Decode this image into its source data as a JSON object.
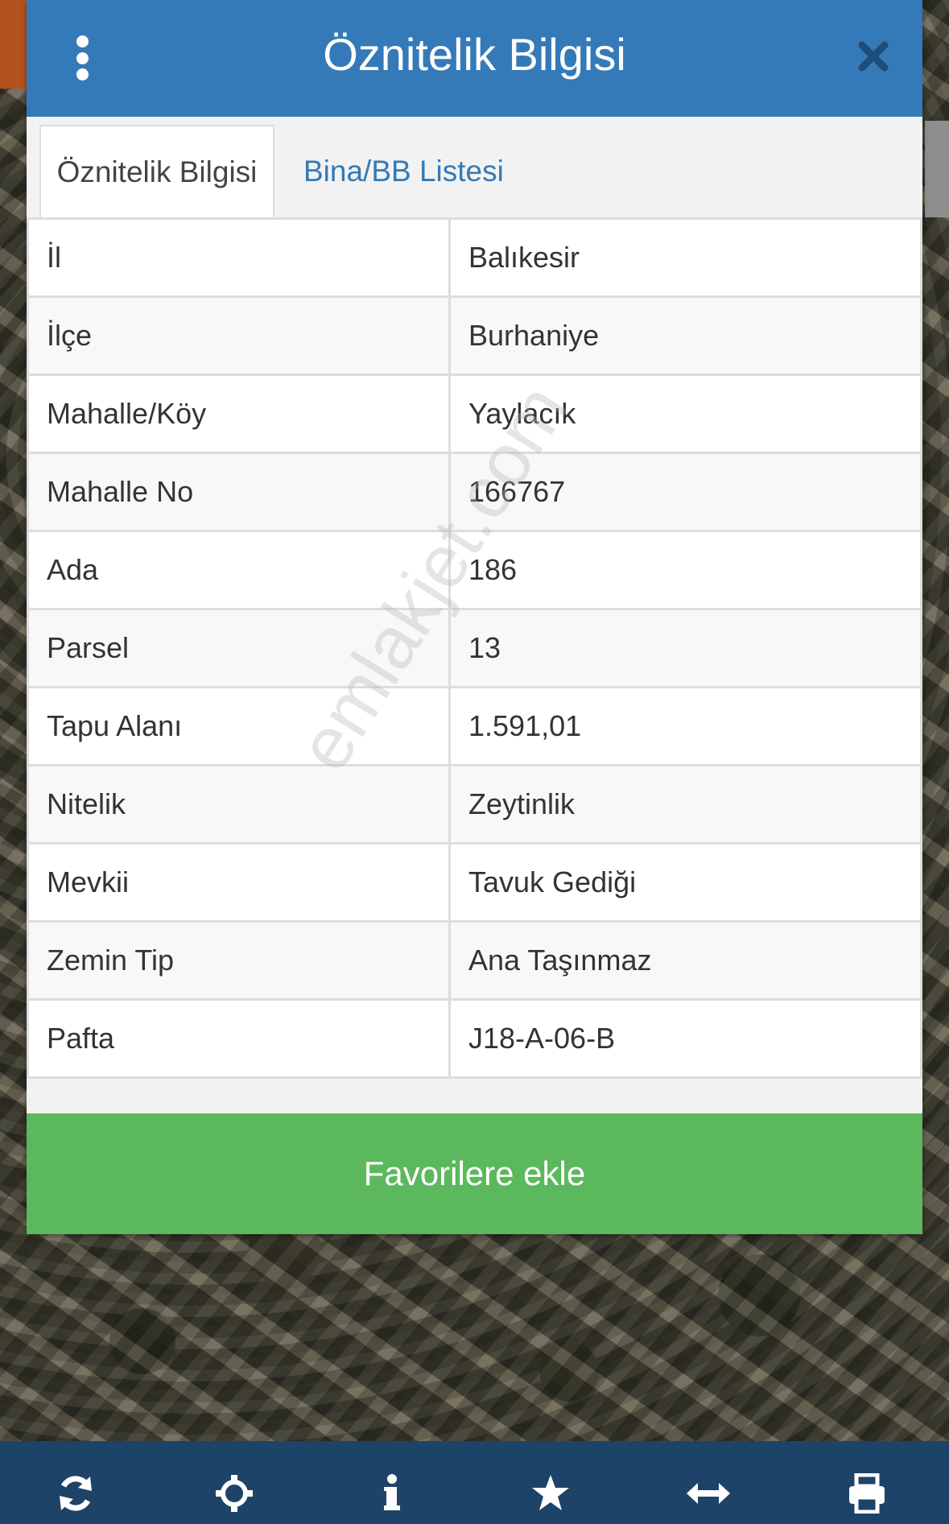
{
  "dialog": {
    "title": "Öznitelik Bilgisi",
    "header_color": "#357ab8"
  },
  "tabs": [
    {
      "label": "Öznitelik Bilgisi",
      "active": true
    },
    {
      "label": "Bina/BB Listesi",
      "active": false
    }
  ],
  "attributes": [
    {
      "key": "İl",
      "value": "Balıkesir"
    },
    {
      "key": "İlçe",
      "value": "Burhaniye"
    },
    {
      "key": "Mahalle/Köy",
      "value": "Yaylacık"
    },
    {
      "key": "Mahalle No",
      "value": "166767"
    },
    {
      "key": "Ada",
      "value": "186"
    },
    {
      "key": "Parsel",
      "value": "13"
    },
    {
      "key": "Tapu Alanı",
      "value": "1.591,01"
    },
    {
      "key": "Nitelik",
      "value": "Zeytinlik"
    },
    {
      "key": "Mevkii",
      "value": "Tavuk Gediği"
    },
    {
      "key": "Zemin Tip",
      "value": "Ana Taşınmaz"
    },
    {
      "key": "Pafta",
      "value": "J18-A-06-B"
    }
  ],
  "favorite_button": {
    "label": "Favorilere ekle",
    "color": "#5cb85c"
  },
  "watermark": "emlakjet.com",
  "toolbar": {
    "icons": [
      "refresh-icon",
      "locate-icon",
      "info-icon",
      "star-icon",
      "measure-icon",
      "print-icon"
    ]
  }
}
